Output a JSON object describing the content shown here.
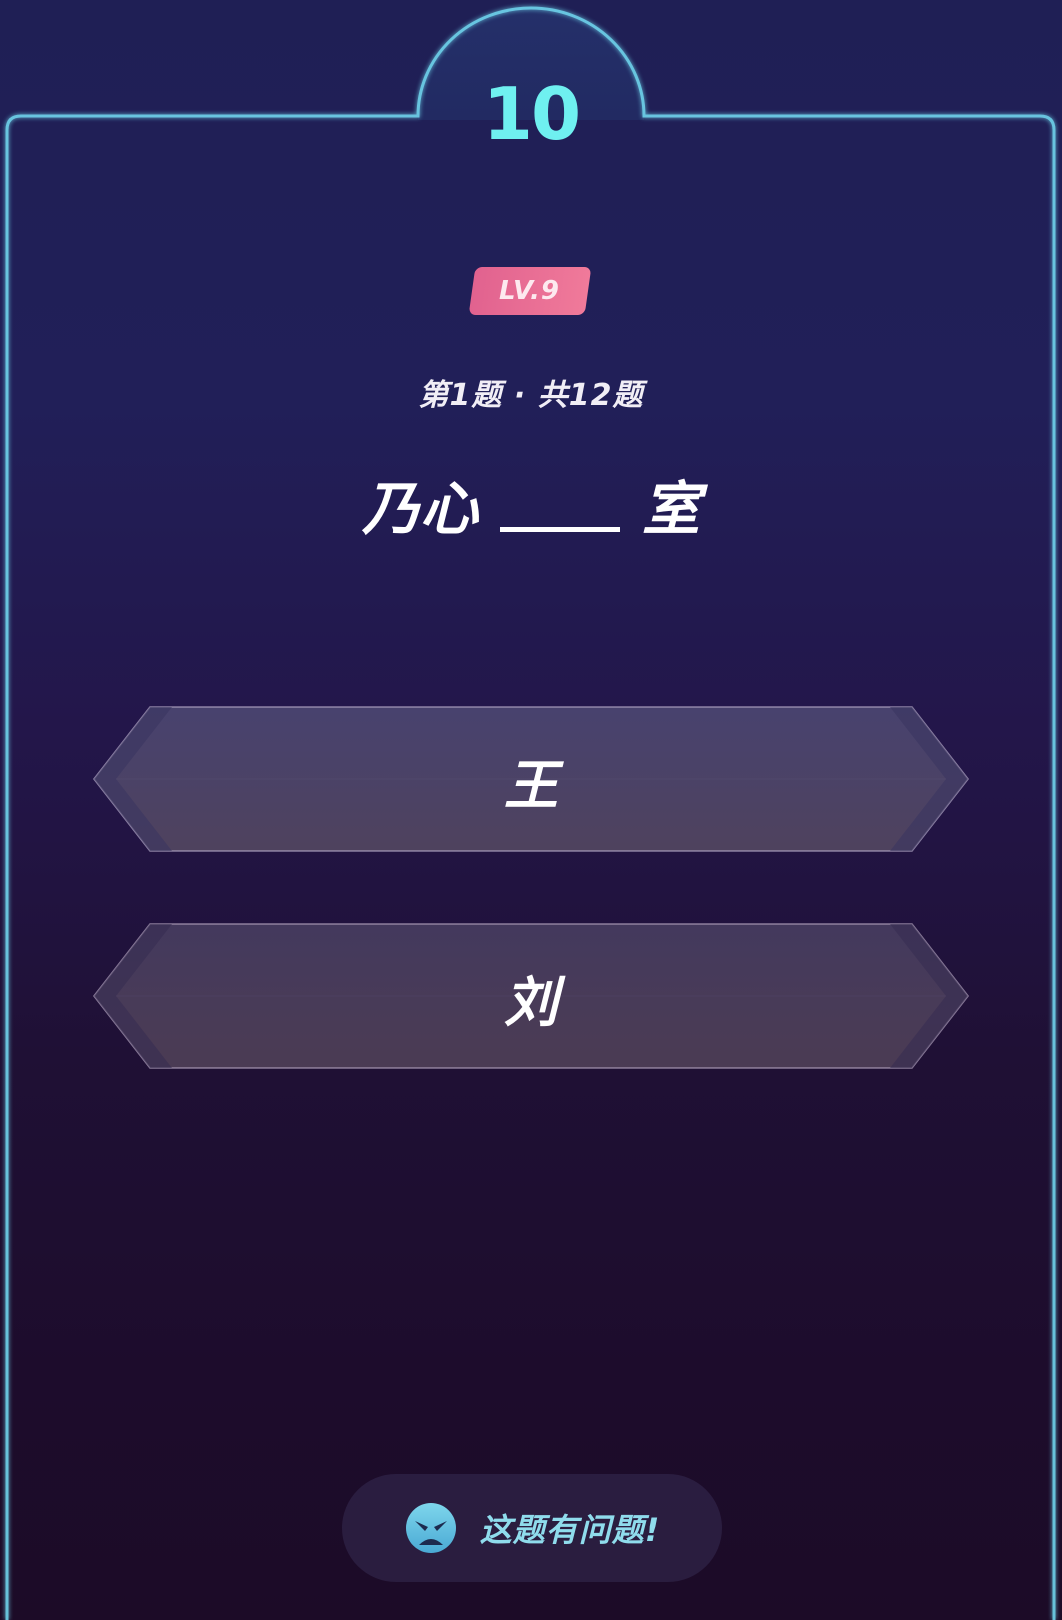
{
  "timer": "10",
  "level": "LV.9",
  "progress": "第1题 · 共12题",
  "question": {
    "before": "乃心",
    "after": "室"
  },
  "options": [
    {
      "label": "王"
    },
    {
      "label": "刘"
    }
  ],
  "report": {
    "label": "这题有问题!",
    "icon": "angry-face-icon"
  },
  "colors": {
    "frame": "#6fd6ee",
    "timer": "#6ff0f0",
    "badge": "#e9718f",
    "report_text": "#8fdcec"
  }
}
